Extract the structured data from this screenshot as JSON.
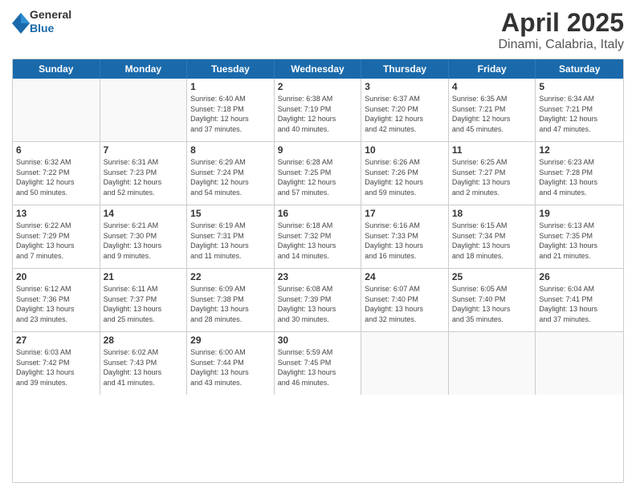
{
  "logo": {
    "general": "General",
    "blue": "Blue"
  },
  "title": "April 2025",
  "subtitle": "Dinami, Calabria, Italy",
  "header_days": [
    "Sunday",
    "Monday",
    "Tuesday",
    "Wednesday",
    "Thursday",
    "Friday",
    "Saturday"
  ],
  "weeks": [
    [
      {
        "day": "",
        "lines": []
      },
      {
        "day": "",
        "lines": []
      },
      {
        "day": "1",
        "lines": [
          "Sunrise: 6:40 AM",
          "Sunset: 7:18 PM",
          "Daylight: 12 hours",
          "and 37 minutes."
        ]
      },
      {
        "day": "2",
        "lines": [
          "Sunrise: 6:38 AM",
          "Sunset: 7:19 PM",
          "Daylight: 12 hours",
          "and 40 minutes."
        ]
      },
      {
        "day": "3",
        "lines": [
          "Sunrise: 6:37 AM",
          "Sunset: 7:20 PM",
          "Daylight: 12 hours",
          "and 42 minutes."
        ]
      },
      {
        "day": "4",
        "lines": [
          "Sunrise: 6:35 AM",
          "Sunset: 7:21 PM",
          "Daylight: 12 hours",
          "and 45 minutes."
        ]
      },
      {
        "day": "5",
        "lines": [
          "Sunrise: 6:34 AM",
          "Sunset: 7:21 PM",
          "Daylight: 12 hours",
          "and 47 minutes."
        ]
      }
    ],
    [
      {
        "day": "6",
        "lines": [
          "Sunrise: 6:32 AM",
          "Sunset: 7:22 PM",
          "Daylight: 12 hours",
          "and 50 minutes."
        ]
      },
      {
        "day": "7",
        "lines": [
          "Sunrise: 6:31 AM",
          "Sunset: 7:23 PM",
          "Daylight: 12 hours",
          "and 52 minutes."
        ]
      },
      {
        "day": "8",
        "lines": [
          "Sunrise: 6:29 AM",
          "Sunset: 7:24 PM",
          "Daylight: 12 hours",
          "and 54 minutes."
        ]
      },
      {
        "day": "9",
        "lines": [
          "Sunrise: 6:28 AM",
          "Sunset: 7:25 PM",
          "Daylight: 12 hours",
          "and 57 minutes."
        ]
      },
      {
        "day": "10",
        "lines": [
          "Sunrise: 6:26 AM",
          "Sunset: 7:26 PM",
          "Daylight: 12 hours",
          "and 59 minutes."
        ]
      },
      {
        "day": "11",
        "lines": [
          "Sunrise: 6:25 AM",
          "Sunset: 7:27 PM",
          "Daylight: 13 hours",
          "and 2 minutes."
        ]
      },
      {
        "day": "12",
        "lines": [
          "Sunrise: 6:23 AM",
          "Sunset: 7:28 PM",
          "Daylight: 13 hours",
          "and 4 minutes."
        ]
      }
    ],
    [
      {
        "day": "13",
        "lines": [
          "Sunrise: 6:22 AM",
          "Sunset: 7:29 PM",
          "Daylight: 13 hours",
          "and 7 minutes."
        ]
      },
      {
        "day": "14",
        "lines": [
          "Sunrise: 6:21 AM",
          "Sunset: 7:30 PM",
          "Daylight: 13 hours",
          "and 9 minutes."
        ]
      },
      {
        "day": "15",
        "lines": [
          "Sunrise: 6:19 AM",
          "Sunset: 7:31 PM",
          "Daylight: 13 hours",
          "and 11 minutes."
        ]
      },
      {
        "day": "16",
        "lines": [
          "Sunrise: 6:18 AM",
          "Sunset: 7:32 PM",
          "Daylight: 13 hours",
          "and 14 minutes."
        ]
      },
      {
        "day": "17",
        "lines": [
          "Sunrise: 6:16 AM",
          "Sunset: 7:33 PM",
          "Daylight: 13 hours",
          "and 16 minutes."
        ]
      },
      {
        "day": "18",
        "lines": [
          "Sunrise: 6:15 AM",
          "Sunset: 7:34 PM",
          "Daylight: 13 hours",
          "and 18 minutes."
        ]
      },
      {
        "day": "19",
        "lines": [
          "Sunrise: 6:13 AM",
          "Sunset: 7:35 PM",
          "Daylight: 13 hours",
          "and 21 minutes."
        ]
      }
    ],
    [
      {
        "day": "20",
        "lines": [
          "Sunrise: 6:12 AM",
          "Sunset: 7:36 PM",
          "Daylight: 13 hours",
          "and 23 minutes."
        ]
      },
      {
        "day": "21",
        "lines": [
          "Sunrise: 6:11 AM",
          "Sunset: 7:37 PM",
          "Daylight: 13 hours",
          "and 25 minutes."
        ]
      },
      {
        "day": "22",
        "lines": [
          "Sunrise: 6:09 AM",
          "Sunset: 7:38 PM",
          "Daylight: 13 hours",
          "and 28 minutes."
        ]
      },
      {
        "day": "23",
        "lines": [
          "Sunrise: 6:08 AM",
          "Sunset: 7:39 PM",
          "Daylight: 13 hours",
          "and 30 minutes."
        ]
      },
      {
        "day": "24",
        "lines": [
          "Sunrise: 6:07 AM",
          "Sunset: 7:40 PM",
          "Daylight: 13 hours",
          "and 32 minutes."
        ]
      },
      {
        "day": "25",
        "lines": [
          "Sunrise: 6:05 AM",
          "Sunset: 7:40 PM",
          "Daylight: 13 hours",
          "and 35 minutes."
        ]
      },
      {
        "day": "26",
        "lines": [
          "Sunrise: 6:04 AM",
          "Sunset: 7:41 PM",
          "Daylight: 13 hours",
          "and 37 minutes."
        ]
      }
    ],
    [
      {
        "day": "27",
        "lines": [
          "Sunrise: 6:03 AM",
          "Sunset: 7:42 PM",
          "Daylight: 13 hours",
          "and 39 minutes."
        ]
      },
      {
        "day": "28",
        "lines": [
          "Sunrise: 6:02 AM",
          "Sunset: 7:43 PM",
          "Daylight: 13 hours",
          "and 41 minutes."
        ]
      },
      {
        "day": "29",
        "lines": [
          "Sunrise: 6:00 AM",
          "Sunset: 7:44 PM",
          "Daylight: 13 hours",
          "and 43 minutes."
        ]
      },
      {
        "day": "30",
        "lines": [
          "Sunrise: 5:59 AM",
          "Sunset: 7:45 PM",
          "Daylight: 13 hours",
          "and 46 minutes."
        ]
      },
      {
        "day": "",
        "lines": []
      },
      {
        "day": "",
        "lines": []
      },
      {
        "day": "",
        "lines": []
      }
    ]
  ]
}
